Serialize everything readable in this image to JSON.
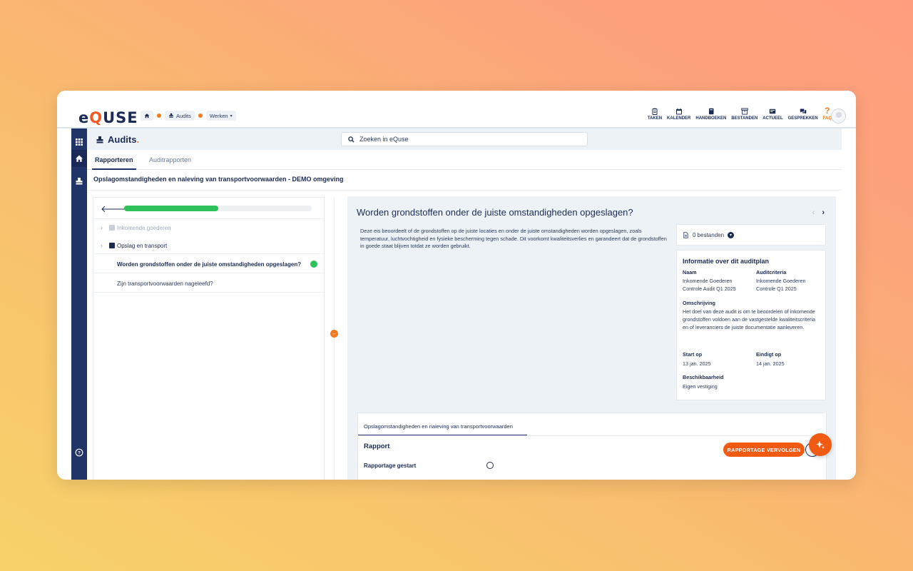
{
  "topbar": {
    "logo_prefix": "e",
    "logo_q": "Q",
    "logo_suffix": "USE",
    "breadcrumb": [
      {
        "label": ""
      },
      {
        "label": "Audits"
      },
      {
        "label": "Werken"
      }
    ],
    "nav": [
      {
        "label": "TAKEN",
        "icon": "clipboard-icon"
      },
      {
        "label": "KALENDER",
        "icon": "calendar-icon"
      },
      {
        "label": "HANDBOEKEN",
        "icon": "book-icon"
      },
      {
        "label": "BESTANDEN",
        "icon": "archive-icon"
      },
      {
        "label": "ACTUEEL",
        "icon": "news-icon"
      },
      {
        "label": "GESPREKKEN",
        "icon": "chat-icon"
      },
      {
        "label": "FAQ",
        "icon": "question-icon"
      }
    ]
  },
  "header": {
    "title": "Audits",
    "title_dot": ".",
    "search_placeholder": "Zoeken in eQuse"
  },
  "tabs": [
    "Rapporteren",
    "Auditrapporten"
  ],
  "page_subtitle": "Opslagomstandigheden en naleving van transportvoorwaarden - DEMO omgeving",
  "left_panel": {
    "progress": 0.5,
    "tree": [
      {
        "label": "Inkomende goederen",
        "muted": true
      },
      {
        "label": "Opslag en transport",
        "muted": false
      }
    ],
    "questions": [
      {
        "label": "Worden grondstoffen onder de juiste omstandigheden opgeslagen?",
        "active": true,
        "status_color": "#2ec05a"
      },
      {
        "label": "Zijn transportvoorwaarden nageleefd?",
        "active": false
      }
    ]
  },
  "question": {
    "title": "Worden grondstoffen onder de juiste omstandigheden opgeslagen?",
    "description": "Deze eis beoordeelt of de grondstoffen op de juiste locaties en onder de juiste omstandigheden worden opgeslagen, zoals temperatuur, luchtvochtigheid en fysieke bescherming tegen schade. Dit voorkomt kwaliteitsverlies en garandeert dat de grondstoffen in goede staat blijven totdat ze worden gebruikt.",
    "files_label": "0 bestanden"
  },
  "info": {
    "heading": "Informatie over dit auditplan",
    "naam_label": "Naam",
    "naam_value": "Inkomende Goederen Controle Audit Q1 2025",
    "criteria_label": "Auditcriteria",
    "criteria_value": "Inkomende Goederen Controle Q1 2025",
    "omschrijving_label": "Omschrijving",
    "omschrijving_value": "Het doel van deze audit is om te beoordelen of inkomende grondstoffen voldoen aan de vastgestelde kwaliteitscriteria en of leveranciers de juiste documentatie aanleveren.",
    "start_label": "Start op",
    "start_value": "13 jan. 2025",
    "end_label": "Eindigt op",
    "end_value": "14 jan. 2025",
    "beschik_label": "Beschikbaarheid",
    "beschik_value": "Eigen vestiging"
  },
  "report": {
    "tab": "Opslagomstandigheden en naleving van transportvoorwaarden",
    "heading": "Rapport",
    "started": "Rapportage gestart",
    "button": "RAPPORTAGE VERVOLGEN"
  },
  "colors": {
    "navy": "#213468",
    "accent": "#f15a12",
    "success": "#2ec05a"
  }
}
